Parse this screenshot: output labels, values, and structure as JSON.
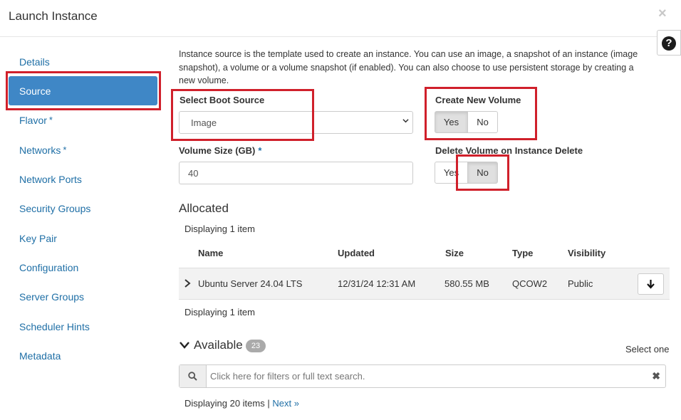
{
  "modal": {
    "title": "Launch Instance",
    "close_symbol": "×",
    "help_symbol": "?"
  },
  "sidebar": {
    "items": [
      {
        "label": "Details",
        "required": false
      },
      {
        "label": "Source",
        "required": false,
        "active": true
      },
      {
        "label": "Flavor",
        "required": true
      },
      {
        "label": "Networks",
        "required": true
      },
      {
        "label": "Network Ports",
        "required": false
      },
      {
        "label": "Security Groups",
        "required": false
      },
      {
        "label": "Key Pair",
        "required": false
      },
      {
        "label": "Configuration",
        "required": false
      },
      {
        "label": "Server Groups",
        "required": false
      },
      {
        "label": "Scheduler Hints",
        "required": false
      },
      {
        "label": "Metadata",
        "required": false
      }
    ],
    "required_marker": "*"
  },
  "source": {
    "description_line1": "Instance source is the template used to create an instance. You can use an image, a snapshot of an instance (image",
    "description_line2": "snapshot), a volume or a volume snapshot (if enabled). You can also choose to use persistent storage by creating a",
    "description_line3": "new volume.",
    "boot_source": {
      "label": "Select Boot Source",
      "value": "Image"
    },
    "create_volume": {
      "label": "Create New Volume",
      "yes": "Yes",
      "no": "No",
      "selected": "Yes"
    },
    "volume_size": {
      "label": "Volume Size (GB)",
      "value": "40",
      "required_marker": "*"
    },
    "delete_on_terminate": {
      "label": "Delete Volume on Instance Delete",
      "yes": "Yes",
      "no": "No",
      "selected": "No"
    }
  },
  "allocated": {
    "title": "Allocated",
    "count_top": "Displaying 1 item",
    "count_bottom": "Displaying 1 item",
    "columns": [
      "Name",
      "Updated",
      "Size",
      "Type",
      "Visibility"
    ],
    "rows": [
      {
        "name": "Ubuntu Server 24.04 LTS",
        "updated": "12/31/24 12:31 AM",
        "size": "580.55 MB",
        "type": "QCOW2",
        "visibility": "Public"
      }
    ]
  },
  "available": {
    "title": "Available",
    "count_badge": "23",
    "select_hint": "Select one",
    "search_placeholder": "Click here for filters or full text search.",
    "displaying": "Displaying 20 items",
    "separator": "|",
    "next_label": "Next »"
  },
  "colors": {
    "accent": "#3f87c6",
    "link": "#1f6fa6",
    "highlight": "#d0202b"
  }
}
